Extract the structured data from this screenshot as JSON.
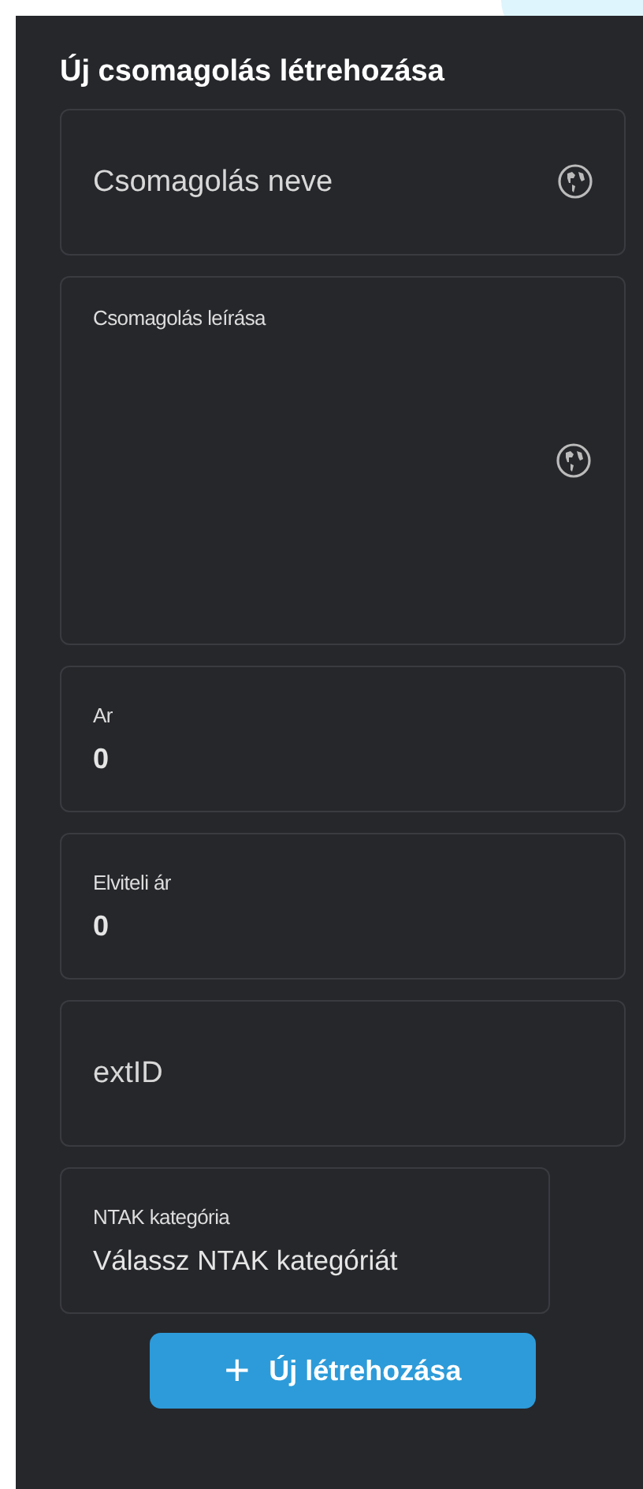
{
  "title": "Új csomagolás létrehozása",
  "fields": [
    {
      "kind": "text",
      "placeholder": "Csomagolás neve",
      "translatable": true
    },
    {
      "kind": "textarea",
      "label": "Csomagolás leírása",
      "translatable": true
    },
    {
      "kind": "number",
      "label": "Ar",
      "value": "0"
    },
    {
      "kind": "number",
      "label": "Elviteli ár",
      "value": "0"
    },
    {
      "kind": "text",
      "placeholder": "extID"
    },
    {
      "kind": "select",
      "label": "NTAK kategória",
      "value": "Válassz NTAK kategóriát"
    }
  ],
  "button": {
    "icon": "+",
    "label": "Új létrehozása"
  }
}
